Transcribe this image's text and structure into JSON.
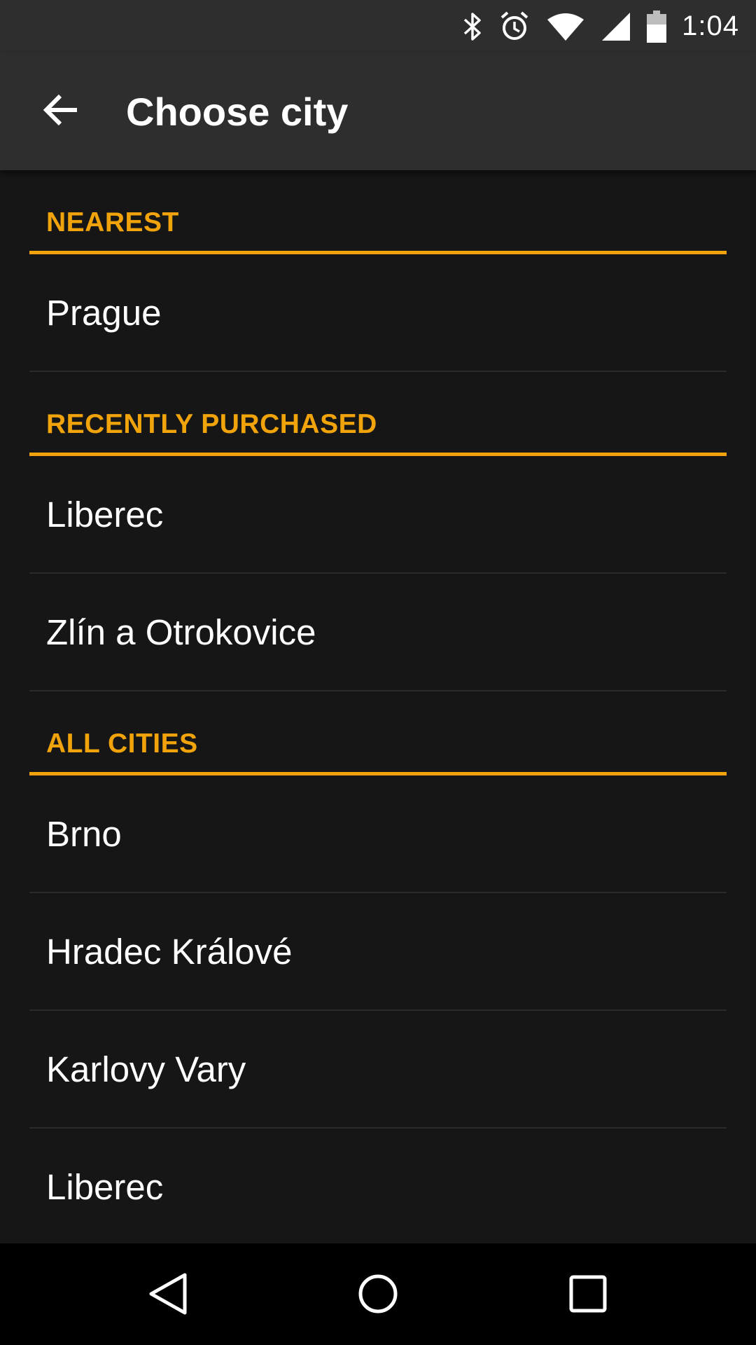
{
  "status_bar": {
    "time": "1:04",
    "icons": [
      "bluetooth-icon",
      "alarm-icon",
      "wifi-icon",
      "cell-signal-icon",
      "battery-icon"
    ]
  },
  "app_bar": {
    "title": "Choose city",
    "back_icon": "arrow-back-icon"
  },
  "sections": {
    "nearest": {
      "header": "NEAREST",
      "items": [
        "Prague"
      ]
    },
    "recently_purchased": {
      "header": "RECENTLY PURCHASED",
      "items": [
        "Liberec",
        "Zlín a Otrokovice"
      ]
    },
    "all_cities": {
      "header": "ALL CITIES",
      "items": [
        "Brno",
        "Hradec Králové",
        "Karlovy Vary",
        "Liberec"
      ]
    }
  },
  "nav_bar": {
    "icons": [
      "nav-back-icon",
      "nav-home-icon",
      "nav-recents-icon"
    ]
  },
  "colors": {
    "accent": "#f0a30a",
    "background": "#161616",
    "app_bar": "#2e2e2e",
    "nav_bar": "#000000",
    "text": "#ffffff",
    "divider": "#2a2a2a"
  }
}
